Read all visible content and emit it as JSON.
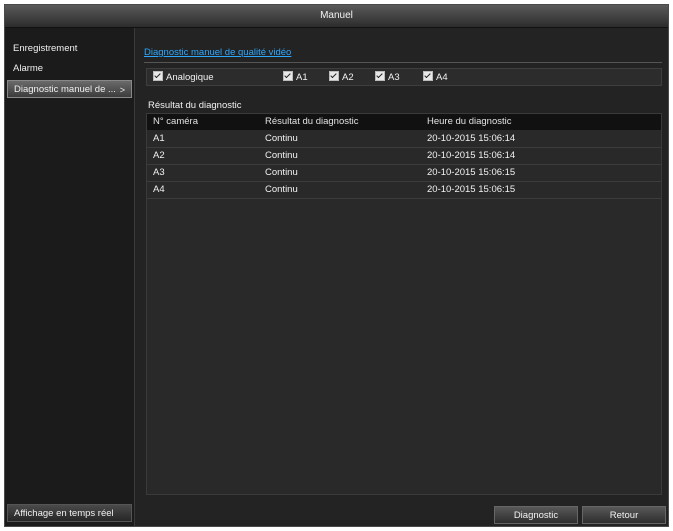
{
  "window": {
    "title": "Manuel"
  },
  "sidebar": {
    "items": [
      {
        "label": "Enregistrement"
      },
      {
        "label": "Alarme"
      },
      {
        "label": "Diagnostic manuel de ...",
        "chevron": ">"
      }
    ],
    "live_view": "Affichage en temps réel"
  },
  "main": {
    "section_title": "Diagnostic manuel de qualité vidéo",
    "checkboxes": {
      "analog": "Analogique",
      "a1": "A1",
      "a2": "A2",
      "a3": "A3",
      "a4": "A4"
    },
    "result_label": "Résultat du diagnostic",
    "table": {
      "headers": [
        "N° caméra",
        "Résultat du diagnostic",
        "Heure du diagnostic"
      ],
      "rows": [
        [
          "A1",
          "Continu",
          "20-10-2015 15:06:14"
        ],
        [
          "A2",
          "Continu",
          "20-10-2015 15:06:14"
        ],
        [
          "A3",
          "Continu",
          "20-10-2015 15:06:15"
        ],
        [
          "A4",
          "Continu",
          "20-10-2015 15:06:15"
        ]
      ]
    },
    "buttons": {
      "diagnostic": "Diagnostic",
      "back": "Retour"
    }
  }
}
